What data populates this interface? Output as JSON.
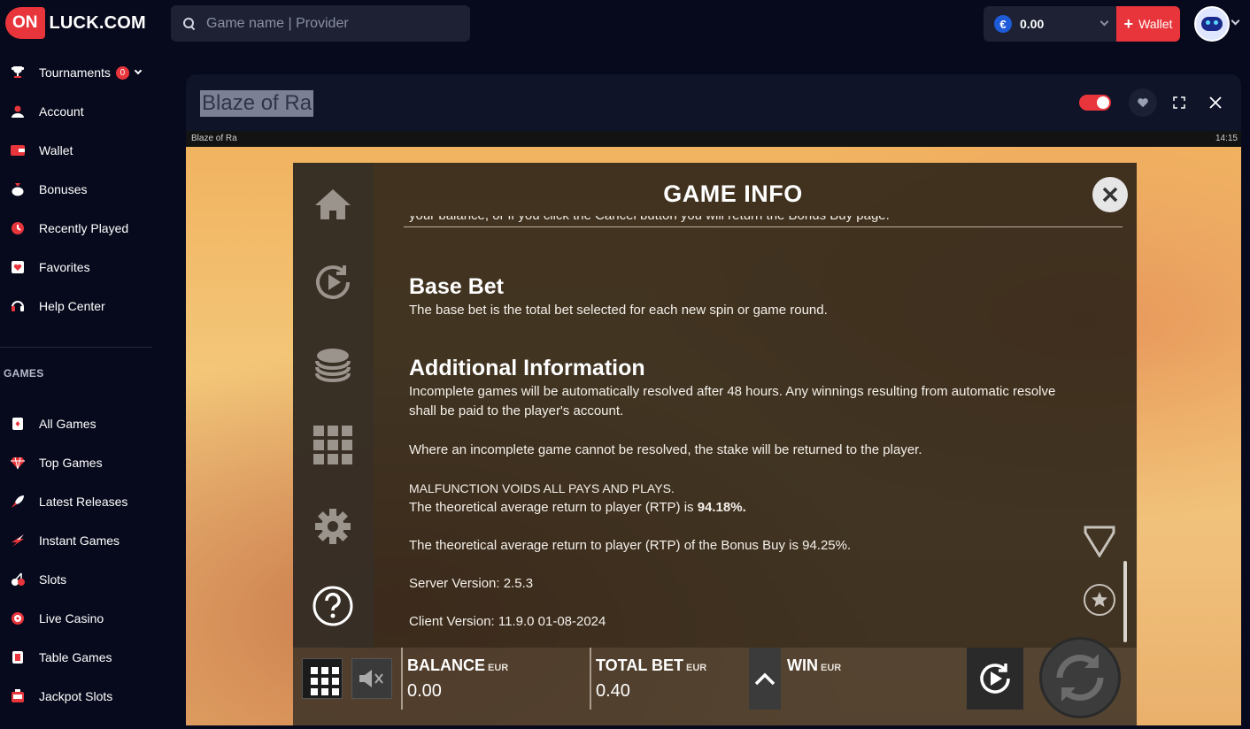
{
  "header": {
    "logo_on": "ON",
    "logo_rest": "LUCK.COM",
    "search_placeholder": "Game name | Provider",
    "balance": "0.00",
    "currency_symbol": "€",
    "wallet_label": "Wallet",
    "wallet_plus": "+"
  },
  "sidebar": {
    "items": [
      {
        "label": "Tournaments",
        "icon": "trophy-icon",
        "badge": "0"
      },
      {
        "label": "Account",
        "icon": "user-icon"
      },
      {
        "label": "Wallet",
        "icon": "wallet-icon"
      },
      {
        "label": "Bonuses",
        "icon": "money-bag-icon"
      },
      {
        "label": "Recently Played",
        "icon": "clock-icon"
      },
      {
        "label": "Favorites",
        "icon": "favorites-icon"
      },
      {
        "label": "Help Center",
        "icon": "headset-icon"
      }
    ],
    "games_section": "GAMES",
    "game_items": [
      {
        "label": "All Games",
        "icon": "cards-icon"
      },
      {
        "label": "Top Games",
        "icon": "diamond-icon"
      },
      {
        "label": "Latest Releases",
        "icon": "rocket-icon"
      },
      {
        "label": "Instant Games",
        "icon": "lightning-icon"
      },
      {
        "label": "Slots",
        "icon": "cherries-icon"
      },
      {
        "label": "Live Casino",
        "icon": "roulette-icon"
      },
      {
        "label": "Table Games",
        "icon": "card-table-icon"
      },
      {
        "label": "Jackpot Slots",
        "icon": "jackpot-icon"
      }
    ]
  },
  "game": {
    "title": "Blaze of Ra",
    "strip_title": "Blaze of Ra",
    "clock": "14:15"
  },
  "modal": {
    "title": "GAME INFO",
    "cut_text": "your balance, or if you click the Cancel button you will return the Bonus Buy page.",
    "sections": [
      {
        "heading": "Base Bet",
        "body": "The base bet is the total bet selected for each new spin or game round."
      },
      {
        "heading": "Additional Information"
      }
    ],
    "paragraphs": {
      "p1": "Incomplete games will be automatically resolved after 48 hours. Any winnings resulting from automatic resolve shall be paid to the player's account.",
      "p2": "Where an incomplete game cannot be resolved, the stake will be returned to the player.",
      "p3a": "MALFUNCTION VOIDS ALL PAYS AND PLAYS.",
      "p3b": "The theoretical average return to player (RTP) is ",
      "rtp": "94.18%.",
      "p4": "The theoretical average return to player (RTP) of the Bonus Buy is 94.25%.",
      "server": "Server Version: 2.5.3",
      "client": "Client Version: 11.9.0 01-08-2024"
    }
  },
  "bottombar": {
    "balance_label": "BALANCE",
    "balance_unit": "EUR",
    "balance_value": "0.00",
    "bet_label": "TOTAL BET",
    "bet_unit": "EUR",
    "bet_value": "0.40",
    "win_label": "WIN",
    "win_unit": "EUR"
  }
}
